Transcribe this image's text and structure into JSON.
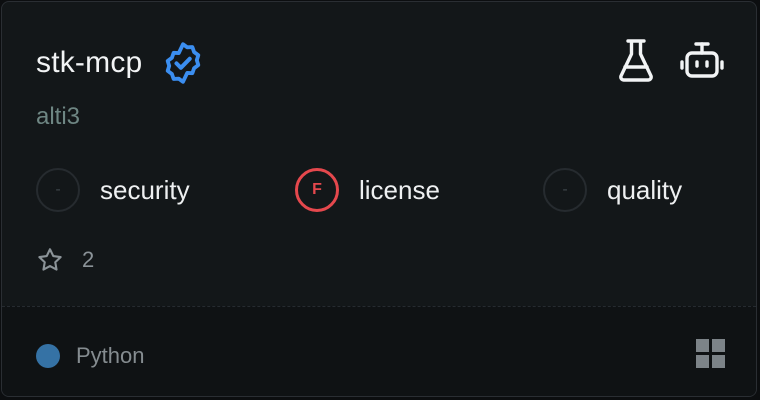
{
  "server": {
    "name": "stk-mcp",
    "author": "alti3",
    "verified": true
  },
  "top_icons": [
    "flask-icon",
    "robot-icon"
  ],
  "scores": [
    {
      "label": "security",
      "grade": "-",
      "status": "none"
    },
    {
      "label": "license",
      "grade": "F",
      "status": "fail"
    },
    {
      "label": "quality",
      "grade": "-",
      "status": "none"
    }
  ],
  "stars": {
    "count": "2"
  },
  "footer": {
    "language": "Python",
    "language_color": "#3572a5",
    "platform_icon": "windows-icon"
  },
  "colors": {
    "verified_badge": "#3b8ef0",
    "fail": "#e5484d"
  }
}
